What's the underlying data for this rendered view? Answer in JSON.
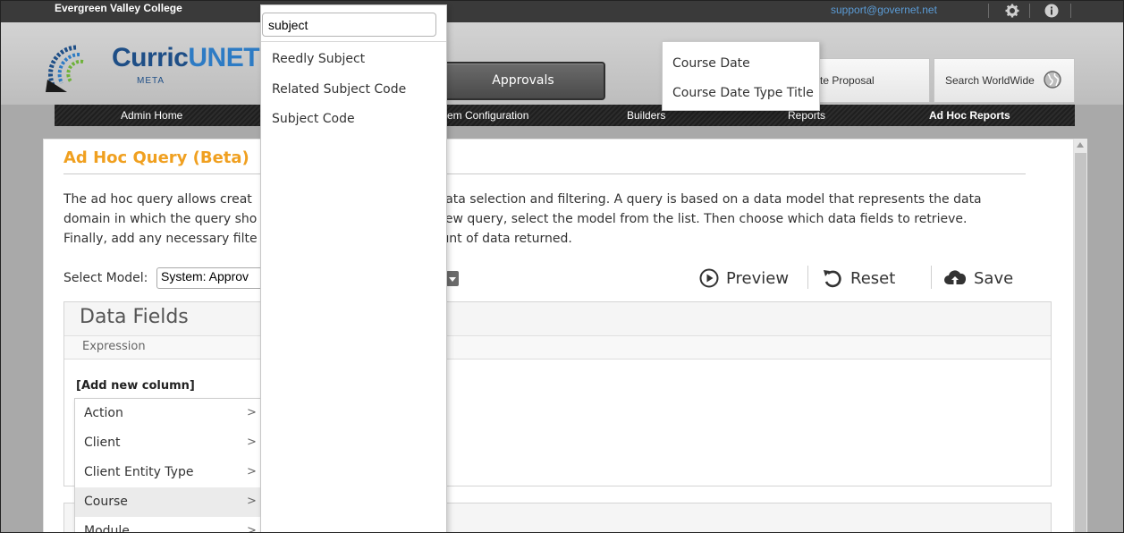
{
  "topbar": {
    "college": "Evergreen Valley College",
    "support_email": "support@governet.net",
    "icons": [
      "gear-icon",
      "info-icon"
    ]
  },
  "header": {
    "logo_text_main": "Curric",
    "logo_text_accent": "UNET",
    "logo_sub": "META",
    "approvals_label": "Approvals",
    "create_proposal_label": "te Proposal",
    "search_worldwide_label": "Search WorldWide",
    "search_worldwide_icon": "globe-icon"
  },
  "nav": {
    "items": [
      {
        "label": "Admin Home"
      },
      {
        "label": "em Configuration"
      },
      {
        "label": "Builders"
      },
      {
        "label": "Reports"
      },
      {
        "label": "Ad Hoc Reports",
        "active": true
      }
    ]
  },
  "page": {
    "title": "Ad Hoc Query (Beta)",
    "desc_lines": [
      {
        "left": "The ad hoc query allows creat",
        "right": "n data selection and filtering. A query is based on a data model that represents the data"
      },
      {
        "left": "domain in which the query sho",
        "right": "a new query, select the model from the list. Then choose which data fields to retrieve."
      },
      {
        "left": "Finally, add any necessary filte",
        "right": "nount of data returned."
      }
    ],
    "select_label": "Select Model:",
    "select_value": "System: Approv",
    "preview_label": "Preview",
    "reset_label": "Reset",
    "save_label": "Save",
    "data_fields_title": "Data Fields",
    "expression_label": "Expression",
    "add_column_label": "[Add new column]"
  },
  "entity_menu": {
    "items": [
      {
        "label": "Action",
        "arrow": ">"
      },
      {
        "label": "Client",
        "arrow": ">"
      },
      {
        "label": "Client Entity Type",
        "arrow": ">"
      },
      {
        "label": "Course",
        "arrow": ">",
        "hover": true
      },
      {
        "label": "Module",
        "arrow": ">"
      }
    ]
  },
  "search_popup": {
    "query": "subject",
    "results": [
      "Reedly Subject",
      "Related Subject Code",
      "Subject Code"
    ]
  },
  "field_popup": {
    "items": [
      "Course Date",
      "Course Date Type Title"
    ]
  },
  "colors": {
    "title_accent": "#f0a020",
    "link": "#5b9bd5",
    "logo_blue": "#1e4e86"
  }
}
